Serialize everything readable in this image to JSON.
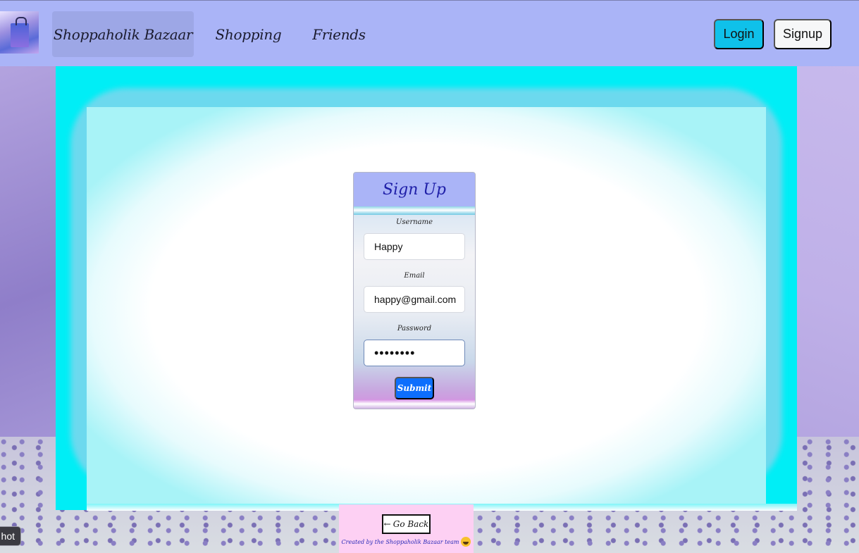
{
  "navbar": {
    "brand": "Shoppaholik Bazaar",
    "links": [
      "Shopping",
      "Friends"
    ],
    "login_label": "Login",
    "signup_label": "Signup",
    "logo_icon": "shopping-bag-logo-icon"
  },
  "signup_form": {
    "title": "Sign Up",
    "username_label": "Username",
    "username_value": "Happy",
    "email_label": "Email",
    "email_value": "happy@gmail.com",
    "password_label": "Password",
    "password_value": "••••••••",
    "submit_label": "Submit"
  },
  "footer": {
    "go_back_arrow": "←",
    "go_back_label": "Go Back",
    "credit": "Created by the Shoppaholik Bazaar team"
  },
  "edge_chip": {
    "label": "hot"
  },
  "colors": {
    "navbar_bg": "#aab4f7",
    "login_bg": "#0fc1ea",
    "glow_frame": "#00eef6",
    "submit_bg": "#0d6efd",
    "footer_bg": "#fdd0f3",
    "form_title": "#1f1fa8"
  }
}
